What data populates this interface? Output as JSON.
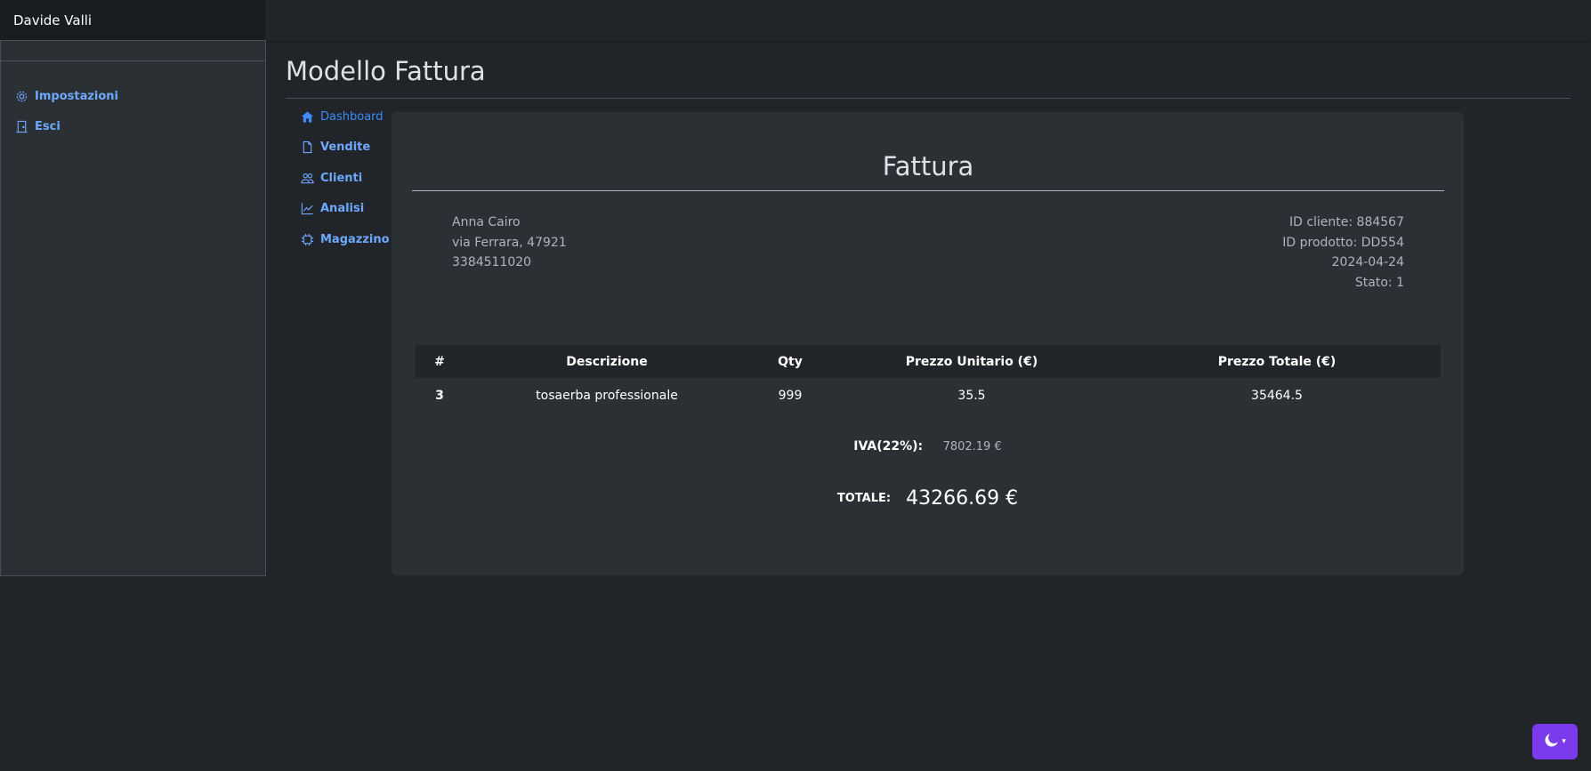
{
  "brand": {
    "name": "Davide Valli"
  },
  "sidebar": {
    "main_items": [
      {
        "label": "Dashboard",
        "icon": "house-icon",
        "active": true
      },
      {
        "label": "Vendite",
        "icon": "file-icon"
      },
      {
        "label": "Clienti",
        "icon": "people-icon"
      },
      {
        "label": "Analisi",
        "icon": "chart-line-icon"
      },
      {
        "label": "Magazzino",
        "icon": "cpu-icon"
      }
    ],
    "bottom_items": [
      {
        "label": "Impostazioni",
        "icon": "gear-icon"
      },
      {
        "label": "Esci",
        "icon": "door-icon"
      }
    ]
  },
  "page": {
    "title": "Modello Fattura"
  },
  "invoice": {
    "heading": "Fattura",
    "client": {
      "name": "Anna Cairo",
      "address": "via Ferrara, 47921",
      "phone": "3384511020"
    },
    "meta": {
      "client_id": "ID cliente: 884567",
      "product_id": "ID prodotto: DD554",
      "date": "2024-04-24",
      "status": "Stato: 1"
    },
    "table": {
      "headers": [
        "#",
        "Descrizione",
        "Qty",
        "Prezzo Unitario (€)",
        "Prezzo Totale (€)"
      ],
      "rows": [
        [
          "3",
          "tosaerba professionale",
          "999",
          "35.5",
          "35464.5"
        ]
      ]
    },
    "iva": {
      "label": "IVA(22%):",
      "value": "7802.19 €"
    },
    "total": {
      "label": "TOTALE:",
      "value": "43266.69 €"
    }
  },
  "theme_toggle": {
    "icon": "moon-icon",
    "caret": "▾"
  },
  "colors": {
    "background": "#212529",
    "card": "#2b3035",
    "link": "#6ea8fe",
    "link_active": "#3d8bfd",
    "toggle": "#7c3aed"
  }
}
